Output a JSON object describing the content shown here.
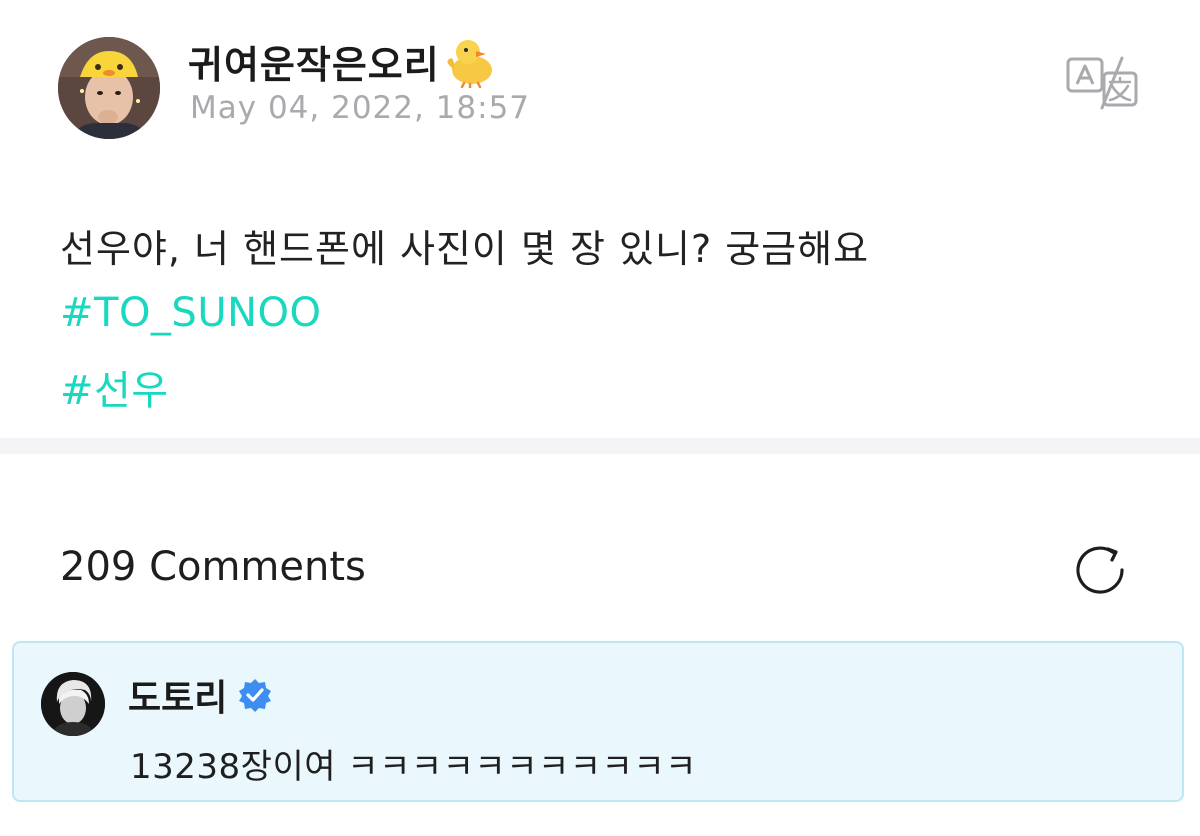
{
  "post": {
    "author": "귀여운작은오리",
    "author_emoji_icon": "baby-chick-icon",
    "date": "May 04, 2022, 18:57",
    "text": "선우야, 너 핸드폰에 사진이 몇 장 있니? 궁금해요",
    "hashtags": [
      "#TO_SUNOO",
      "#선우"
    ],
    "translate_icon": "translate-icon"
  },
  "comments": {
    "count_label": "209 Comments",
    "refresh_icon": "refresh-icon",
    "items": [
      {
        "author": "도토리",
        "verified_icon": "verified-badge-icon",
        "text": "13238장이여 ㅋㅋㅋㅋㅋㅋㅋㅋㅋㅋㅋ"
      }
    ]
  },
  "colors": {
    "hashtag": "#18d8bf",
    "date": "#a9a9ae",
    "highlight_background": "#eaf8fe",
    "highlight_border": "#bfe6f5",
    "verified": "#3d8ef0"
  }
}
